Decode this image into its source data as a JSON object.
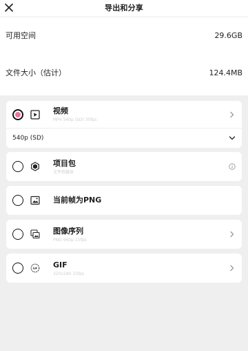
{
  "header": {
    "title": "导出和分享"
  },
  "info": {
    "available_space_label": "可用空间",
    "available_space_value": "29.6GB",
    "file_size_label": "文件大小（估计）",
    "file_size_value": "124.4MB"
  },
  "options": {
    "video": {
      "title": "视频",
      "subtitle": "MP4 540p (SD) 30fps",
      "selected": true,
      "resolution": "540p (SD)"
    },
    "project": {
      "title": "项目包",
      "subtitle": "文件和媒体"
    },
    "png": {
      "title": "当前帧为PNG"
    },
    "sequence": {
      "title": "图像序列",
      "subtitle": "PNG 960p 15fps"
    },
    "gif": {
      "title": "GIF",
      "subtitle": "320x180 15fps"
    }
  },
  "colors": {
    "selected_radio": "#e8749b",
    "background": "#efefef",
    "card": "#ffffff"
  }
}
